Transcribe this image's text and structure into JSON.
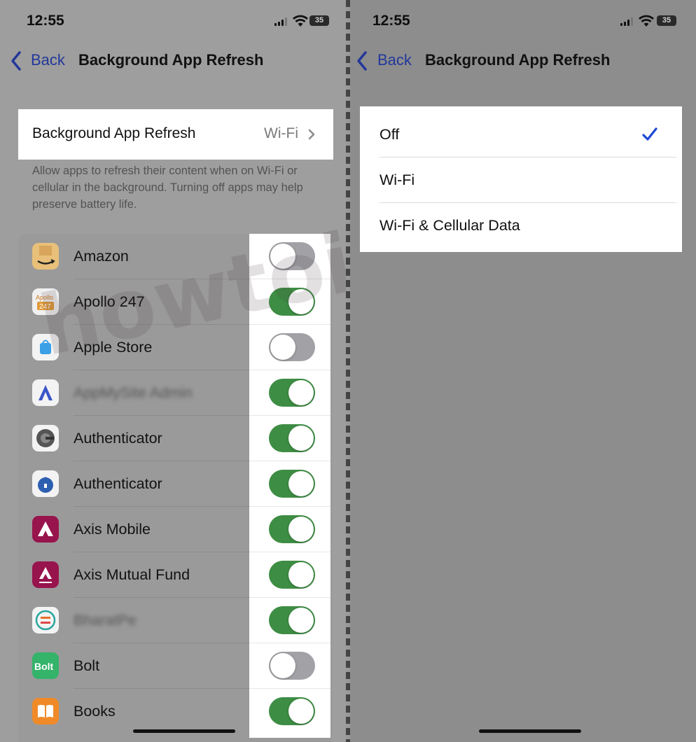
{
  "status_bar": {
    "time": "12:55",
    "battery": "35"
  },
  "left_screen": {
    "nav": {
      "back_label": "Back",
      "title": "Background App Refresh"
    },
    "setting": {
      "label": "Background App Refresh",
      "value": "Wi-Fi"
    },
    "description": "Allow apps to refresh their content when on Wi-Fi or cellular in the background. Turning off apps may help preserve battery life.",
    "apps": [
      {
        "name": "Amazon",
        "icon": "amazon-icon",
        "enabled": false,
        "blurred": false
      },
      {
        "name": "Apollo 247",
        "icon": "apollo-247-icon",
        "enabled": true,
        "blurred": false
      },
      {
        "name": "Apple Store",
        "icon": "apple-store-icon",
        "enabled": false,
        "blurred": false
      },
      {
        "name": "AppMySite Admin",
        "icon": "appmysite-icon",
        "enabled": true,
        "blurred": true
      },
      {
        "name": "Authenticator",
        "icon": "authenticator-icon",
        "enabled": true,
        "blurred": false
      },
      {
        "name": "Authenticator",
        "icon": "authenticator-lock-icon",
        "enabled": true,
        "blurred": false
      },
      {
        "name": "Axis Mobile",
        "icon": "axis-mobile-icon",
        "enabled": true,
        "blurred": false
      },
      {
        "name": "Axis Mutual Fund",
        "icon": "axis-mutual-fund-icon",
        "enabled": true,
        "blurred": false
      },
      {
        "name": "BharatPe",
        "icon": "bharatpe-icon",
        "enabled": true,
        "blurred": true
      },
      {
        "name": "Bolt",
        "icon": "bolt-icon",
        "enabled": false,
        "blurred": false
      },
      {
        "name": "Books",
        "icon": "books-icon",
        "enabled": true,
        "blurred": false
      }
    ]
  },
  "right_screen": {
    "nav": {
      "back_label": "Back",
      "title": "Background App Refresh"
    },
    "options": [
      {
        "label": "Off",
        "selected": true
      },
      {
        "label": "Wi-Fi",
        "selected": false
      },
      {
        "label": "Wi-Fi & Cellular Data",
        "selected": false
      }
    ]
  },
  "watermark": "howtoisolve.com",
  "colors": {
    "toggle_on": "#3e8d44",
    "toggle_off": "#a1a1a6",
    "accent": "#1e48d6"
  }
}
